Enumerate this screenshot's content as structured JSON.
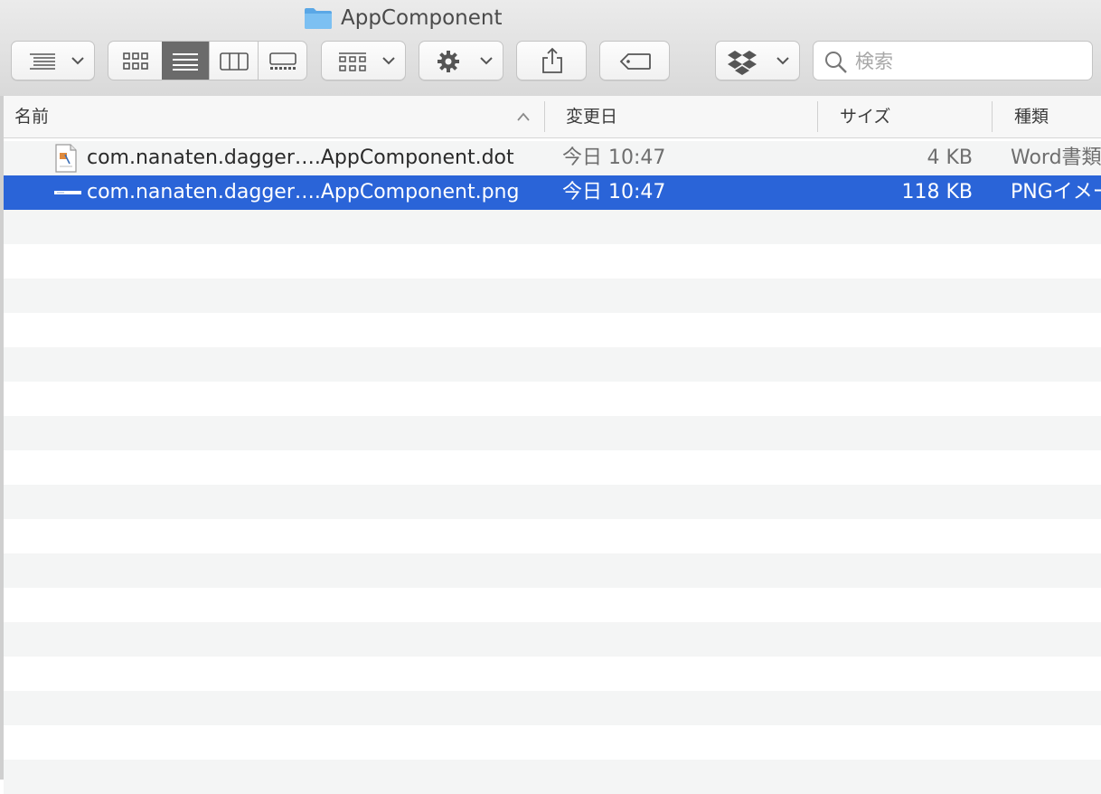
{
  "window": {
    "title": "AppComponent"
  },
  "toolbar": {
    "search_placeholder": "検索",
    "view_mode_selected": "list"
  },
  "columns": {
    "name": "名前",
    "date": "変更日",
    "size": "サイズ",
    "kind": "種類",
    "sorted_by": "name"
  },
  "files": [
    {
      "name": "com.nanaten.dagger….AppComponent.dot",
      "date": "今日 10:47",
      "size": "4 KB",
      "kind": "Word書類",
      "selected": false
    },
    {
      "name": "com.nanaten.dagger….AppComponent.png",
      "date": "今日 10:47",
      "size": "118 KB",
      "kind": "PNGイメージ",
      "selected": true
    }
  ],
  "colors": {
    "selection": "#2a64d8",
    "stripe": "#f4f5f5",
    "folder": "#6cb4ee"
  }
}
